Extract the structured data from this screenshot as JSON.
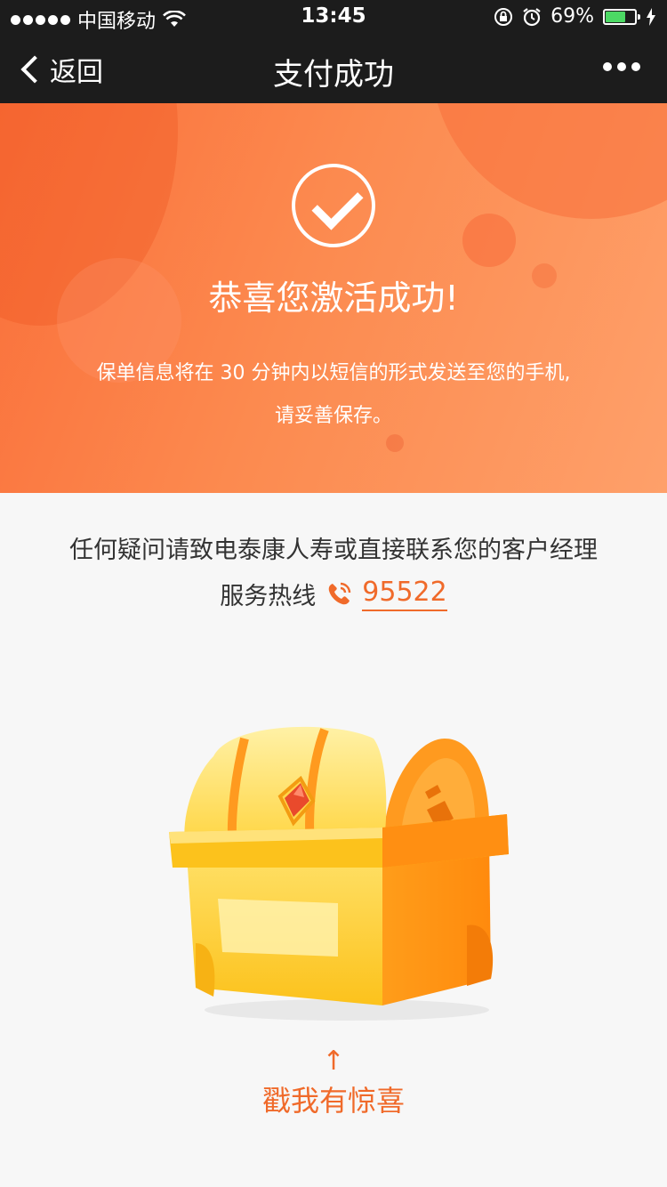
{
  "status_bar": {
    "carrier": "中国移动",
    "time": "13:45",
    "battery_text": "69%",
    "battery_level": 0.69,
    "icons": [
      "signal-dots-icon",
      "wifi-icon",
      "rotation-lock-icon",
      "alarm-icon",
      "battery-icon",
      "charging-icon"
    ]
  },
  "nav": {
    "back_label": "返回",
    "title": "支付成功",
    "more_icon": "more-dots-icon"
  },
  "hero": {
    "title": "恭喜您激活成功!",
    "desc_line1": "保单信息将在 30 分钟内以短信的形式发送至您的手机,",
    "desc_line2": "请妥善保存。",
    "icon": "check-circle-icon"
  },
  "contact": {
    "line": "任何疑问请致电泰康人寿或直接联系您的客户经理",
    "hotline_label": "服务热线",
    "hotline_number": "95522",
    "phone_icon": "phone-icon"
  },
  "promo": {
    "arrow": "↑",
    "label": "戳我有惊喜",
    "image": "treasure-chest-icon"
  },
  "colors": {
    "accent": "#f06a2a",
    "nav_bg": "#1c1c1c",
    "hero_start": "#fa6f3a",
    "hero_end": "#fea06a",
    "page_bg": "#f7f7f7"
  }
}
